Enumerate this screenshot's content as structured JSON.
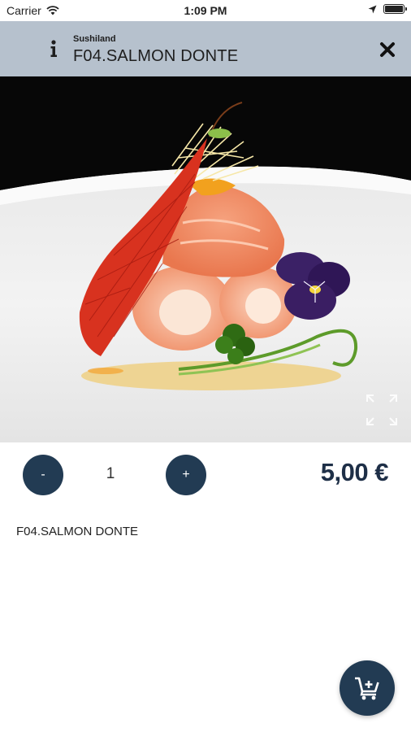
{
  "status_bar": {
    "carrier": "Carrier",
    "time": "1:09 PM",
    "icons": [
      "wifi-icon",
      "location-arrow-icon",
      "battery-icon"
    ]
  },
  "header": {
    "restaurant": "Sushiland",
    "title": "F04.SALMON DONTE",
    "background_color": "#b6c1cd",
    "left_icon": "info-icon",
    "right_icon": "close-icon"
  },
  "product": {
    "image_alt": "Salmon rolls with tuile and flower",
    "expand_icon": "expand-icon",
    "quantity": "1",
    "minus_label": "-",
    "plus_label": "+",
    "price": "5,00 €",
    "description": "F04.SALMON DONTE"
  },
  "cart_button": {
    "icon": "cart-add-icon",
    "color": "#223b53"
  }
}
